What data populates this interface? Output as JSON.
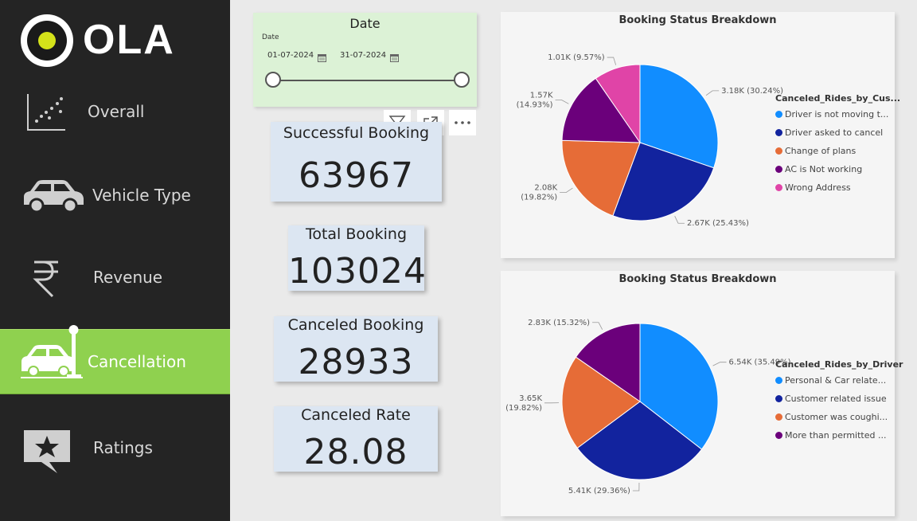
{
  "nav": {
    "logo_text": "OLA",
    "items": [
      {
        "label": "Overall",
        "icon": "scatter-chart-icon",
        "active": false
      },
      {
        "label": "Vehicle Type",
        "icon": "car-icon",
        "active": false
      },
      {
        "label": "Revenue",
        "icon": "rupee-icon",
        "active": false
      },
      {
        "label": "Cancellation",
        "icon": "car-crash-icon",
        "active": true
      },
      {
        "label": "Ratings",
        "icon": "star-message-icon",
        "active": false
      }
    ]
  },
  "date_slicer": {
    "title": "Date",
    "field_label": "Date",
    "start": "01-07-2024",
    "end": "31-07-2024"
  },
  "kpis": [
    {
      "label": "Successful Booking",
      "value": "63967"
    },
    {
      "label": "Total Booking",
      "value": "103024"
    },
    {
      "label": "Canceled Booking",
      "value": "28933"
    },
    {
      "label": "Canceled Rate",
      "value": "28.08"
    }
  ],
  "visual_header": [
    "filter-icon",
    "focus-mode-icon",
    "more-options-icon"
  ],
  "colors": {
    "sidebar_bg": "#242424",
    "active_green": "#8fd14f",
    "slicer_bg": "#dcf2d6",
    "kpi_bg": "#dce6f2"
  },
  "chart_data": [
    {
      "type": "pie",
      "title": "Booking Status Breakdown",
      "legend_title": "Canceled_Rides_by_Cus...",
      "legend_position": "right",
      "slices": [
        {
          "name": "Driver is not moving t...",
          "value": 3180,
          "label": "3.18K (30.24%)",
          "color": "#118dff"
        },
        {
          "name": "Driver asked to cancel",
          "value": 2670,
          "label": "2.67K (25.43%)",
          "color": "#12239e"
        },
        {
          "name": "Change of plans",
          "value": 2080,
          "label_lines": [
            "2.08K",
            "(19.82%)"
          ],
          "color": "#e66c37"
        },
        {
          "name": "AC is Not working",
          "value": 1570,
          "label_lines": [
            "1.57K",
            "(14.93%)"
          ],
          "color": "#6b007b"
        },
        {
          "name": "Wrong Address",
          "value": 1010,
          "label": "1.01K (9.57%)",
          "color": "#e044a7"
        }
      ]
    },
    {
      "type": "pie",
      "title": "Booking Status Breakdown",
      "legend_title": "Canceled_Rides_by_Driver",
      "legend_position": "right",
      "slices": [
        {
          "name": "Personal & Car relate...",
          "value": 6540,
          "label": "6.54K (35.49%)",
          "color": "#118dff"
        },
        {
          "name": "Customer related issue",
          "value": 5410,
          "label": "5.41K (29.36%)",
          "color": "#12239e"
        },
        {
          "name": "Customer was coughi...",
          "value": 3650,
          "label_lines": [
            "3.65K",
            "(19.82%)"
          ],
          "color": "#e66c37"
        },
        {
          "name": "More than permitted ...",
          "value": 2830,
          "label": "2.83K (15.32%)",
          "color": "#6b007b"
        }
      ]
    }
  ]
}
